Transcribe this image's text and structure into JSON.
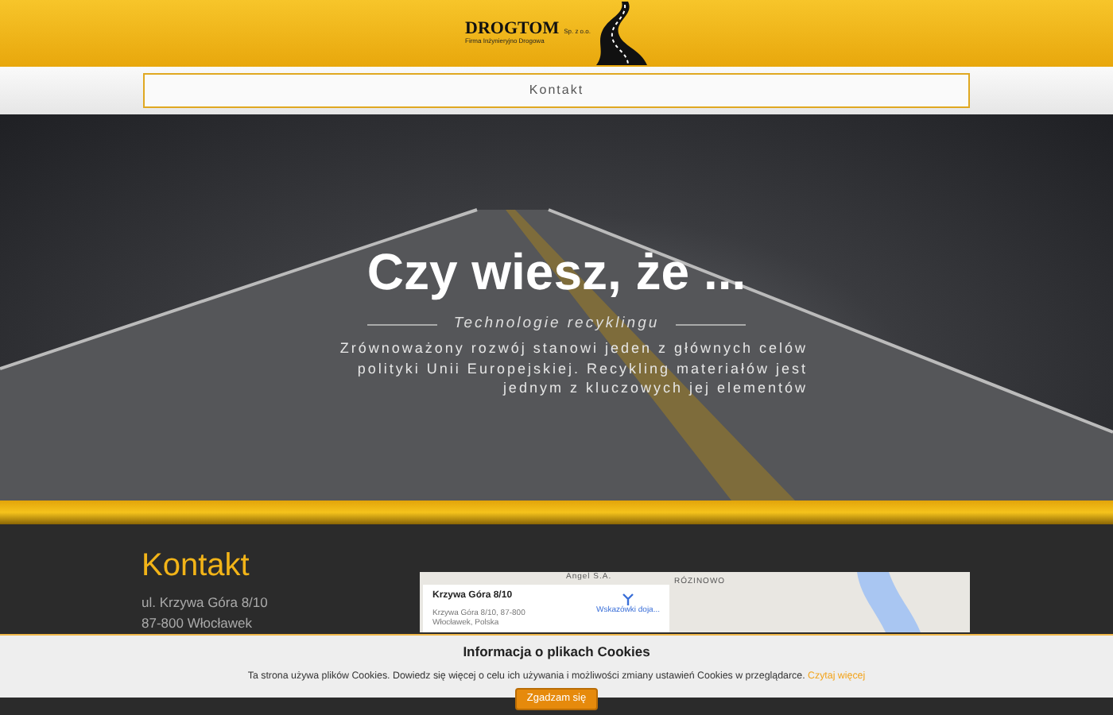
{
  "header": {
    "logo": {
      "name": "DROGTOM",
      "suffix": "Sp. z o.o.",
      "tagline": "Firma Inżynieryjno Drogowa"
    }
  },
  "nav": {
    "menu_label": "Kontakt"
  },
  "hero": {
    "title": "Czy wiesz, że ...",
    "subtitle": "Technologie recyklingu",
    "text": "Zrównoważony rozwój stanowi jeden z głównych celów polityki Unii Europejskiej. Recykling materiałów jest jednym z kluczowych jej elementów"
  },
  "contact": {
    "title": "Kontakt",
    "address_lines": [
      "ul. Krzywa Góra 8/10",
      "87-800 Włocławek"
    ],
    "map": {
      "place_title": "Krzywa Góra 8/10",
      "place_address": [
        "Krzywa Góra 8/10, 87-800",
        "Włocławek, Polska"
      ],
      "directions_label": "Wskazówki doja...",
      "labels": [
        "Angel S.A.",
        "RÓZINOWO"
      ]
    }
  },
  "cookie_notice": {
    "title": "Informacja o plikach Cookies",
    "text": "Ta strona używa plików Cookies. Dowiedz się więcej o celu ich używania i możliwości zmiany ustawień Cookies w przeglądarce.",
    "link": "Czytaj więcej",
    "button": "Zgadzam się"
  }
}
